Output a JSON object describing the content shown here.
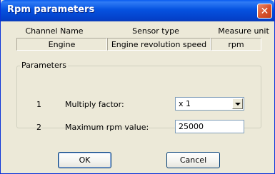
{
  "window": {
    "title": "Rpm parameters"
  },
  "table": {
    "headers": [
      "Channel Name",
      "Sensor type",
      "Measure unit"
    ],
    "row": [
      "Engine",
      "Engine revolution speed",
      "rpm"
    ]
  },
  "parameters": {
    "group_label": "Parameters",
    "rows": [
      {
        "num": "1",
        "label": "Multiply factor:",
        "value": "x 1",
        "control": "dropdown"
      },
      {
        "num": "2",
        "label": "Maximum rpm value:",
        "value": "25000",
        "control": "text-input"
      }
    ]
  },
  "buttons": {
    "ok": "OK",
    "cancel": "Cancel"
  },
  "colors": {
    "titlebar": "#0552e0",
    "dialog_bg": "#ece9d8",
    "close_button": "#d6502a"
  },
  "icons": {
    "close": "close-icon",
    "dropdown": "chevron-down-icon"
  }
}
